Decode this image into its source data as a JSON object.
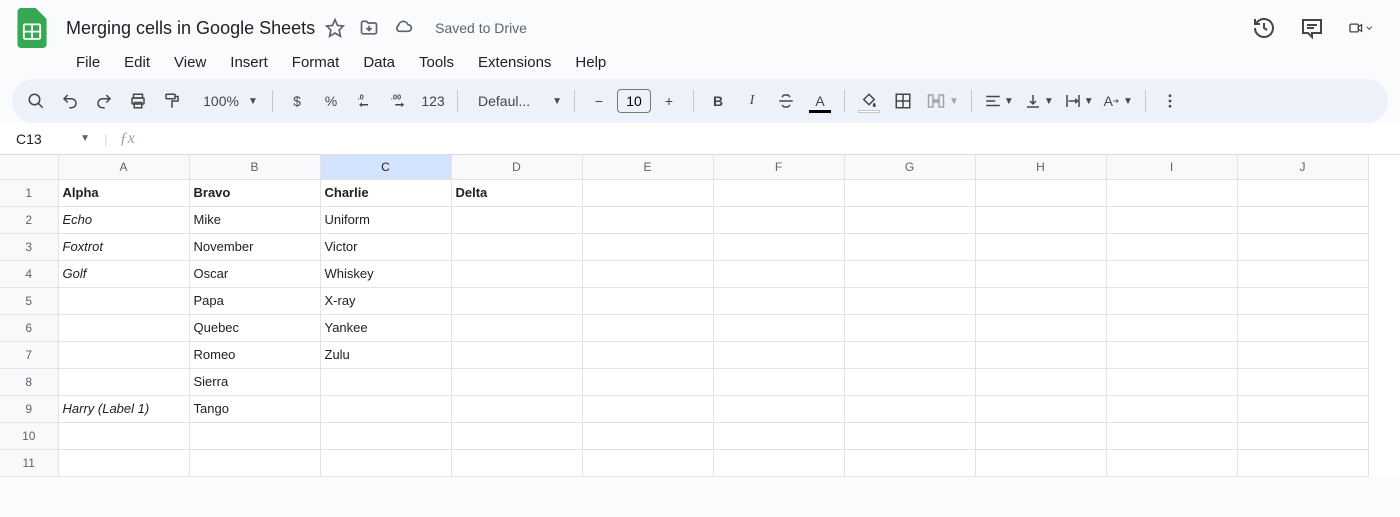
{
  "header": {
    "doc_title": "Merging cells in Google Sheets",
    "saved_text": "Saved to Drive"
  },
  "menus": [
    "File",
    "Edit",
    "View",
    "Insert",
    "Format",
    "Data",
    "Tools",
    "Extensions",
    "Help"
  ],
  "toolbar": {
    "zoom": "100%",
    "dollar": "$",
    "percent": "%",
    "num_123": "123",
    "font_name": "Defaul...",
    "font_size": "10",
    "minus": "−",
    "plus": "+",
    "bold": "B",
    "italic": "I",
    "text_color": "A",
    "format_color": "A"
  },
  "name_box": {
    "reference": "C13"
  },
  "columns": [
    "A",
    "B",
    "C",
    "D",
    "E",
    "F",
    "G",
    "H",
    "I",
    "J"
  ],
  "selected_column": "C",
  "rows": [
    {
      "n": "1",
      "cells": [
        "Alpha",
        "Bravo",
        "Charlie",
        "Delta",
        "",
        "",
        "",
        "",
        "",
        ""
      ],
      "style": [
        "bold",
        "bold",
        "bold",
        "bold",
        "",
        "",
        "",
        "",
        "",
        ""
      ]
    },
    {
      "n": "2",
      "cells": [
        "Echo",
        "Mike",
        "Uniform",
        "",
        "",
        "",
        "",
        "",
        "",
        ""
      ],
      "style": [
        "italic",
        "",
        "",
        "",
        "",
        "",
        "",
        "",
        "",
        ""
      ]
    },
    {
      "n": "3",
      "cells": [
        "Foxtrot",
        "November",
        "Victor",
        "",
        "",
        "",
        "",
        "",
        "",
        ""
      ],
      "style": [
        "italic",
        "",
        "",
        "",
        "",
        "",
        "",
        "",
        "",
        ""
      ]
    },
    {
      "n": "4",
      "cells": [
        "Golf",
        "Oscar",
        "Whiskey",
        "",
        "",
        "",
        "",
        "",
        "",
        ""
      ],
      "style": [
        "italic",
        "",
        "",
        "",
        "",
        "",
        "",
        "",
        "",
        ""
      ]
    },
    {
      "n": "5",
      "cells": [
        "",
        "Papa",
        "X-ray",
        "",
        "",
        "",
        "",
        "",
        "",
        ""
      ],
      "style": [
        "",
        "",
        "",
        "",
        "",
        "",
        "",
        "",
        "",
        ""
      ]
    },
    {
      "n": "6",
      "cells": [
        "",
        "Quebec",
        "Yankee",
        "",
        "",
        "",
        "",
        "",
        "",
        ""
      ],
      "style": [
        "",
        "",
        "",
        "",
        "",
        "",
        "",
        "",
        "",
        ""
      ]
    },
    {
      "n": "7",
      "cells": [
        "",
        "Romeo",
        "Zulu",
        "",
        "",
        "",
        "",
        "",
        "",
        ""
      ],
      "style": [
        "",
        "",
        "",
        "",
        "",
        "",
        "",
        "",
        "",
        ""
      ]
    },
    {
      "n": "8",
      "cells": [
        "",
        "Sierra",
        "",
        "",
        "",
        "",
        "",
        "",
        "",
        ""
      ],
      "style": [
        "",
        "",
        "",
        "",
        "",
        "",
        "",
        "",
        "",
        ""
      ]
    },
    {
      "n": "9",
      "cells": [
        "Harry (Label 1)",
        "Tango",
        "",
        "",
        "",
        "",
        "",
        "",
        "",
        ""
      ],
      "style": [
        "italic",
        "",
        "",
        "",
        "",
        "",
        "",
        "",
        "",
        ""
      ]
    },
    {
      "n": "10",
      "cells": [
        "",
        "",
        "",
        "",
        "",
        "",
        "",
        "",
        "",
        ""
      ],
      "style": [
        "",
        "",
        "",
        "",
        "",
        "",
        "",
        "",
        "",
        ""
      ]
    },
    {
      "n": "11",
      "cells": [
        "",
        "",
        "",
        "",
        "",
        "",
        "",
        "",
        "",
        ""
      ],
      "style": [
        "",
        "",
        "",
        "",
        "",
        "",
        "",
        "",
        "",
        ""
      ]
    }
  ]
}
